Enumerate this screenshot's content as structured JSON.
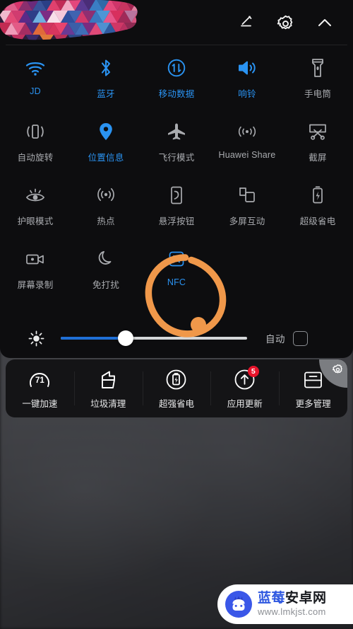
{
  "colors": {
    "active": "#2a93f2",
    "inactive": "#a9abaf",
    "panel_bg": "#0d0d0f",
    "card_bg": "#141416",
    "annotation": "#f0984a",
    "badge": "#e8142b",
    "slider_fill": "#1f6fd6"
  },
  "header": {
    "icons": [
      {
        "name": "edit-icon",
        "label": "编辑"
      },
      {
        "name": "settings-gear-icon",
        "label": "设置"
      },
      {
        "name": "chevron-up-icon",
        "label": "收起"
      }
    ],
    "redaction_label": "马赛克涂抹"
  },
  "tiles": [
    [
      {
        "icon": "wifi-icon",
        "label": "JD",
        "state": "on"
      },
      {
        "icon": "bluetooth-icon",
        "label": "蓝牙",
        "state": "on"
      },
      {
        "icon": "mobile-data-icon",
        "label": "移动数据",
        "state": "on"
      },
      {
        "icon": "ringer-icon",
        "label": "响铃",
        "state": "on"
      },
      {
        "icon": "flashlight-icon",
        "label": "手电筒",
        "state": "off"
      }
    ],
    [
      {
        "icon": "auto-rotate-icon",
        "label": "自动旋转",
        "state": "off"
      },
      {
        "icon": "location-pin-icon",
        "label": "位置信息",
        "state": "on"
      },
      {
        "icon": "airplane-icon",
        "label": "飞行模式",
        "state": "off"
      },
      {
        "icon": "huawei-share-icon",
        "label": "Huawei Share",
        "state": "off"
      },
      {
        "icon": "screenshot-icon",
        "label": "截屏",
        "state": "off"
      }
    ],
    [
      {
        "icon": "eye-comfort-icon",
        "label": "护眼模式",
        "state": "off"
      },
      {
        "icon": "hotspot-icon",
        "label": "热点",
        "state": "off"
      },
      {
        "icon": "floating-button-icon",
        "label": "悬浮按钮",
        "state": "off"
      },
      {
        "icon": "multi-screen-icon",
        "label": "多屏互动",
        "state": "off"
      },
      {
        "icon": "ultra-power-saving-icon",
        "label": "超级省电",
        "state": "off"
      }
    ],
    [
      {
        "icon": "screen-record-icon",
        "label": "屏幕录制",
        "state": "off"
      },
      {
        "icon": "do-not-disturb-icon",
        "label": "免打扰",
        "state": "off"
      },
      {
        "icon": "nfc-icon",
        "label": "NFC",
        "state": "on"
      },
      {
        "icon": "empty-icon",
        "label": "",
        "state": "off"
      },
      {
        "icon": "empty-icon",
        "label": "",
        "state": "off"
      }
    ]
  ],
  "brightness": {
    "sun_icon": "brightness-sun-icon",
    "value_percent": 35,
    "auto_label": "自动",
    "auto_checked": false
  },
  "annotation": {
    "shape": "hand-drawn-circle",
    "target": "NFC"
  },
  "shortcuts": [
    {
      "icon": "speed-gauge-icon",
      "label": "一键加速",
      "value": "71",
      "badge": ""
    },
    {
      "icon": "trash-clean-icon",
      "label": "垃圾清理",
      "value": "",
      "badge": ""
    },
    {
      "icon": "super-power-save-icon",
      "label": "超强省电",
      "value": "",
      "badge": ""
    },
    {
      "icon": "app-update-icon",
      "label": "应用更新",
      "value": "",
      "badge": "5"
    },
    {
      "icon": "more-manage-icon",
      "label": "更多管理",
      "value": "",
      "badge": ""
    }
  ],
  "card_gear": {
    "icon": "card-settings-gear-icon"
  },
  "watermark": {
    "logo": "blueberry-android-robot-logo",
    "title_blue": "蓝莓",
    "title_dark": "安卓网",
    "url": "www.lmkjst.com"
  }
}
